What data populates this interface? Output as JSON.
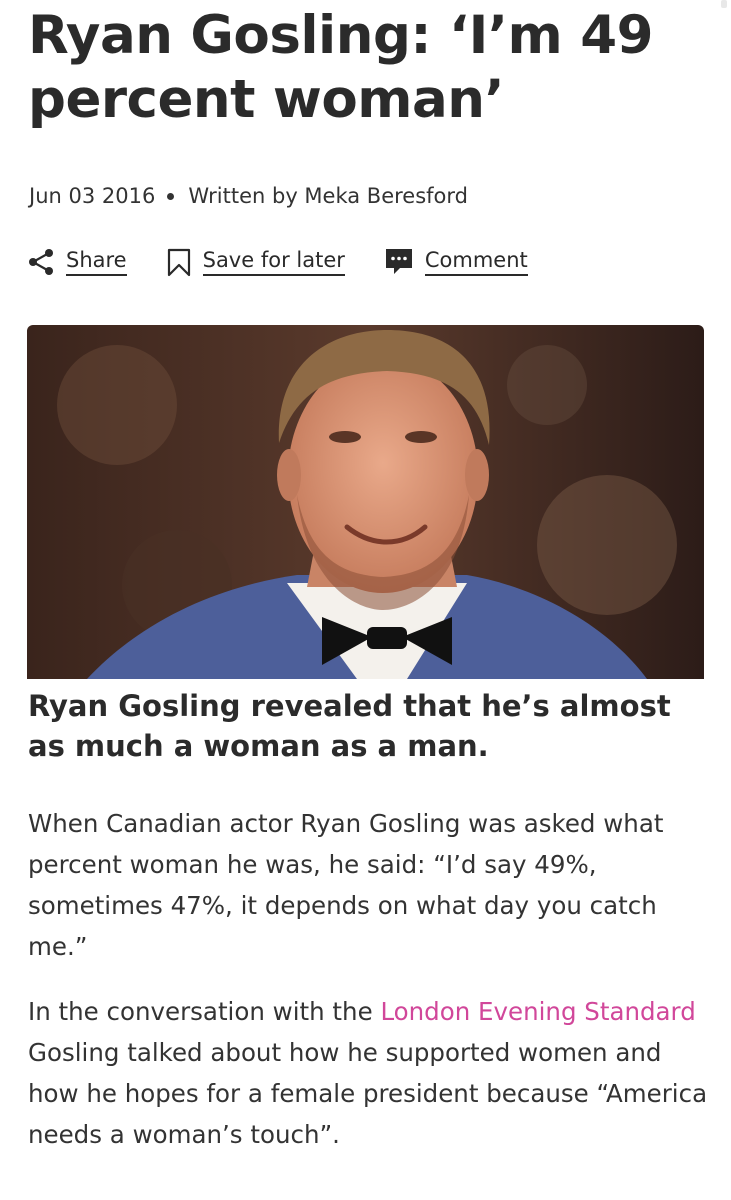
{
  "article": {
    "headline": "Ryan Gosling: ‘I’m 49 percent woman’",
    "date": "Jun 03 2016",
    "byline": "Written by Meka Beresford",
    "actions": {
      "share": "Share",
      "save": "Save for later",
      "comment": "Comment"
    },
    "standfirst": "Ryan Gosling revealed that he’s almost as much a woman as a man.",
    "paragraph1": "When Canadian actor Ryan Gosling was asked what percent woman he was, he said: “I’d say 49%, sometimes 47%, it depends on what day you catch me.”",
    "paragraph2": {
      "before": "In the conversation with the ",
      "link": "London Evening Standard",
      "after": " Gosling talked about how he supported women and how he hopes for a female president because “America needs a woman’s touch”."
    }
  },
  "icons": {
    "share": "share-icon",
    "save": "bookmark-icon",
    "comment": "comment-icon"
  },
  "colors": {
    "text": "#2b2b2b",
    "link": "#d1479a"
  }
}
